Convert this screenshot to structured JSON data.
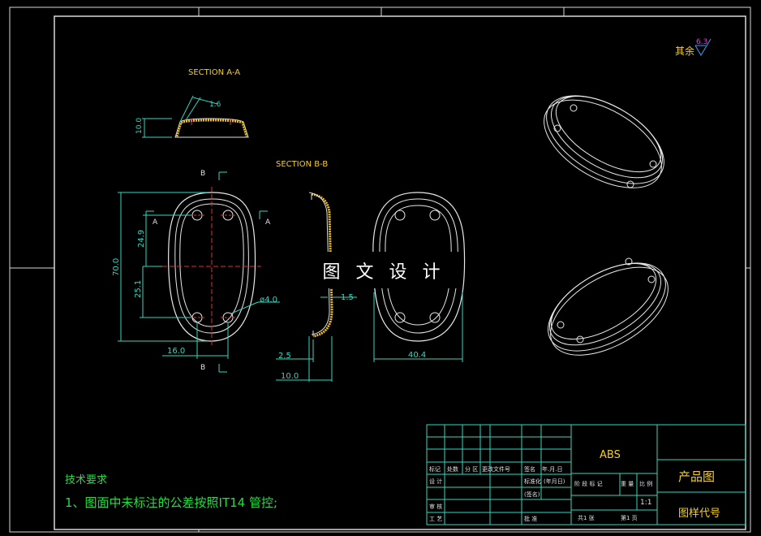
{
  "watermark": "图 文 设 计",
  "roughness": {
    "prefix": "其余",
    "value": "6.3"
  },
  "views": {
    "section_a_title": "SECTION A-A",
    "section_b_title": "SECTION B-B",
    "cut_b_top": "B",
    "cut_b_bottom": "B",
    "cut_a_left": "A",
    "cut_a_right": "A"
  },
  "dimensions": {
    "section_a_thickness": "1.6",
    "section_a_height": "10.0",
    "overall_length": "70.0",
    "upper_hole_offset": "24.9",
    "lower_hole_offset": "25.1",
    "hole_spacing_x": "16.0",
    "hole_diameter": "ø4.0",
    "wall_thickness": "1.5",
    "section_b_base": "2.5",
    "section_b_height": "10.0",
    "overall_width": "40.4"
  },
  "notes": {
    "heading": "技术要求",
    "line1": "1、图面中未标注的公差按照IT14 管控;"
  },
  "title_block": {
    "material": "ABS",
    "drawing_name": "产品图",
    "drawing_code": "图样代号",
    "scale": "1:1",
    "headers": [
      "标记",
      "处数",
      "分 区",
      "更改文件号",
      "签名",
      "年.月.日"
    ],
    "row_design": "设 计",
    "row_standard": "标准化",
    "row_sign": "(签名)",
    "row_date": "(年月日)",
    "row_check": "审 核",
    "row_process": "工 艺",
    "row_approve": "批 准",
    "stage_labels": [
      "阶 段 标 记",
      "重 量",
      "比 例"
    ],
    "sheets_total": "共1 张",
    "sheet_no": "第1 页"
  }
}
